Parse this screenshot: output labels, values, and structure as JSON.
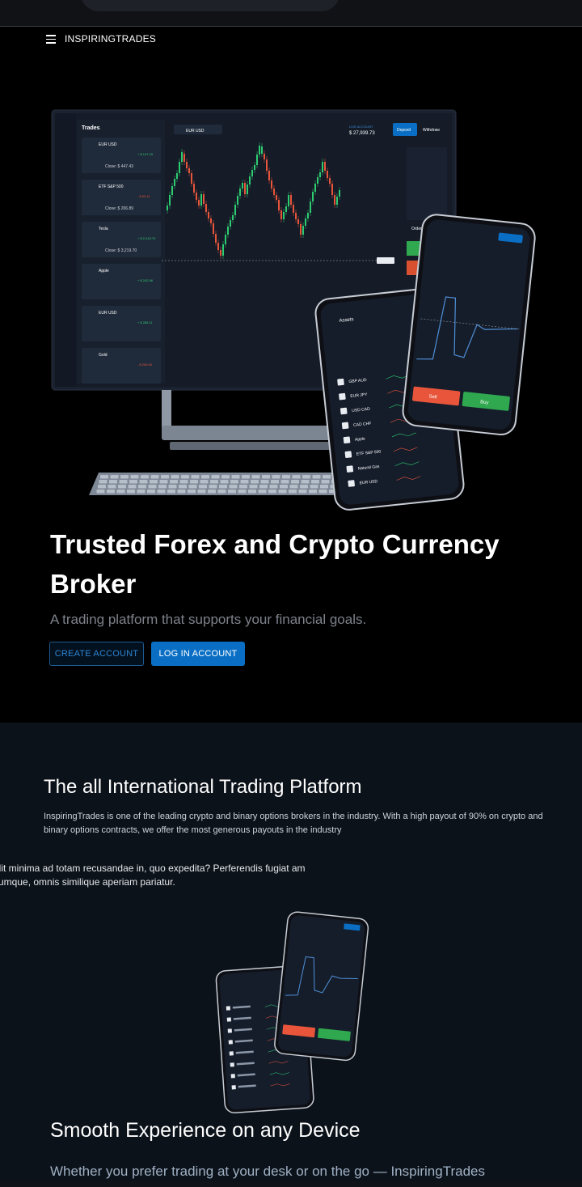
{
  "brand": "INSPIRINGTRADES",
  "hero": {
    "title": "Trusted Forex and Crypto Currency Broker",
    "subtitle": "A trading platform that supports your financial goals.",
    "create_button": "CREATE ACCOUNT",
    "login_button": "LOG IN ACCOUNT"
  },
  "platform_section": {
    "title": "The all International Trading Platform",
    "text": "InspiringTrades is one of the leading crypto and binary options brokers in the industry. With a high payout of 90% on crypto and binary options contracts, we offer the most generous payouts in the industry",
    "lorem": "elit minima ad totam recusandae in, quo expedita? Perferendis fugiat am cumque, omnis similique aperiam pariatur.",
    "device_title": "Smooth Experience on any Device",
    "device_text": "Whether you prefer trading at your desk or on the go — InspiringTrades"
  },
  "mockup": {
    "trades_header": "Trades",
    "pair": "EUR USD",
    "balance_label": "LIVE ACCOUNT",
    "balance": "$ 27,939.73",
    "deposit": "Deposit",
    "withdraw": "Withdraw",
    "order": "Order",
    "assets_header": "Assets",
    "sell": "Sell",
    "buy": "Buy",
    "trade_items": [
      {
        "name": "EUR USD",
        "value": "+ $ 147.43",
        "close": "Close: $ 447.43"
      },
      {
        "name": "ETF S&P 500",
        "value": "- $ 93.11",
        "close": "Close: $ 206.89"
      },
      {
        "name": "Tesla",
        "value": "+ $ 2,249.70",
        "close": "Close: $ 3,219.70"
      },
      {
        "name": "Apple",
        "value": "+ $ 242.56",
        "close": ""
      },
      {
        "name": "EUR USD",
        "value": "+ $ 288.11",
        "close": ""
      },
      {
        "name": "Gold",
        "value": "- $ 200.00",
        "close": ""
      }
    ],
    "asset_list": [
      "GBP AUD",
      "EUR JPY",
      "USD CAD",
      "CAD CHF",
      "Apple",
      "ETF S&P 500",
      "Natural Gas",
      "EUR USD"
    ]
  },
  "colors": {
    "accent": "#0a6fc4",
    "candle_up": "#2ecc71",
    "candle_down": "#e8553a",
    "section_bg": "#0c121a"
  }
}
